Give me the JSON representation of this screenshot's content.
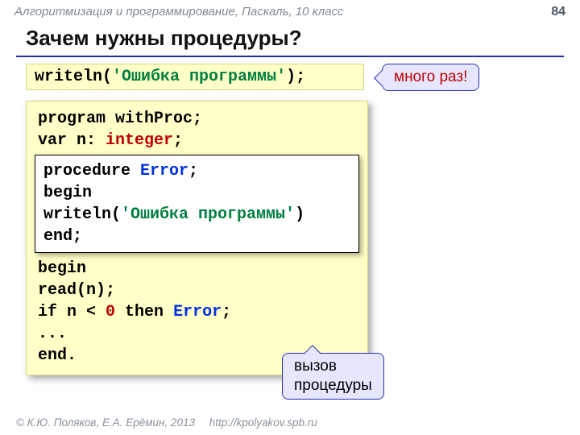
{
  "header": {
    "course": "Алгоритмизация и программирование, Паскаль, 10 класс",
    "page": "84"
  },
  "title": "Зачем нужны процедуры?",
  "top_code": {
    "writeln": "writeln",
    "open": "(",
    "str": "'Ошибка программы'",
    "close": ");"
  },
  "callouts": {
    "many": "много раз!",
    "call_line1": "вызов",
    "call_line2": "процедуры"
  },
  "code": {
    "l1a": "program",
    "l1b": " withProc;",
    "l2a": "var",
    "l2b": " n: ",
    "l2c": "integer",
    "l2d": ";",
    "proc": {
      "p1a": "procedure ",
      "p1b": "Error",
      "p1c": ";",
      "p2": "begin",
      "p3a": "  writeln(",
      "p3b": "'Ошибка программы'",
      "p3c": ")",
      "p4": "end;"
    },
    "m1": "begin",
    "m2": "  read(n);",
    "m3a": "  if",
    "m3b": " n < ",
    "m3c": "0",
    "m3d": " then ",
    "m3e": "Error",
    "m3f": ";",
    "m4": "  ...",
    "m5": "end."
  },
  "footer": {
    "copyright": "© К.Ю. Поляков, Е.А. Ерёмин, 2013",
    "link": "http://kpolyakov.spb.ru"
  }
}
